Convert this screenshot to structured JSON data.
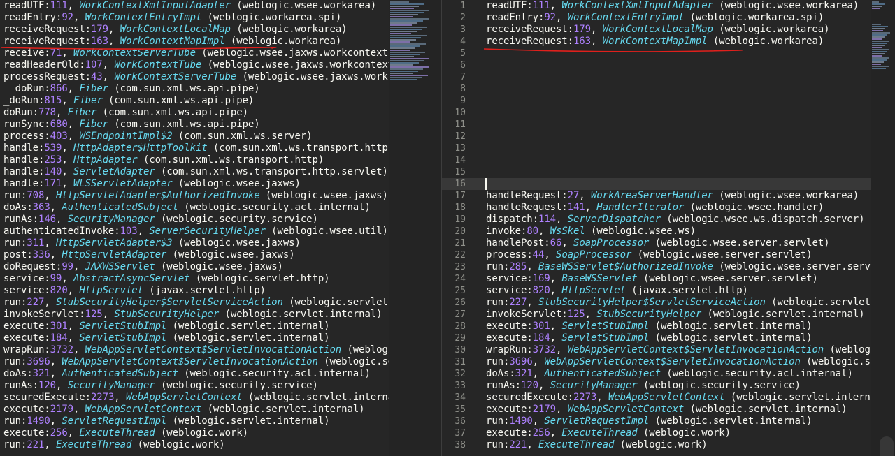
{
  "colors": {
    "background": "#262626",
    "method": "#f8f8f2",
    "line_number": "#ae81ff",
    "class_name": "#66d9ef",
    "annotation_red": "#e0201c",
    "gutter_text": "#8f908a"
  },
  "left_pane": {
    "lines": [
      {
        "m": "readUTF",
        "n": "111",
        "c": "WorkContextXmlInputAdapter",
        "p": "weblogic.wsee.workarea"
      },
      {
        "m": "readEntry",
        "n": "92",
        "c": "WorkContextEntryImpl",
        "p": "weblogic.workarea.spi"
      },
      {
        "m": "receiveRequest",
        "n": "179",
        "c": "WorkContextLocalMap",
        "p": "weblogic.workarea"
      },
      {
        "m": "receiveRequest",
        "n": "163",
        "c": "WorkContextMapImpl",
        "p": "weblogic.workarea"
      },
      {
        "m": "receive",
        "n": "71",
        "c": "WorkContextServerTube",
        "p": "weblogic.wsee.jaxws.workcontext"
      },
      {
        "m": "readHeaderOld",
        "n": "107",
        "c": "WorkContextTube",
        "p": "weblogic.wsee.jaxws.workcontext"
      },
      {
        "m": "processRequest",
        "n": "43",
        "c": "WorkContextServerTube",
        "p": "weblogic.wsee.jaxws.workcon"
      },
      {
        "m": "__doRun",
        "n": "866",
        "c": "Fiber",
        "p": "com.sun.xml.ws.api.pipe"
      },
      {
        "m": "_doRun",
        "n": "815",
        "c": "Fiber",
        "p": "com.sun.xml.ws.api.pipe"
      },
      {
        "m": "doRun",
        "n": "778",
        "c": "Fiber",
        "p": "com.sun.xml.ws.api.pipe"
      },
      {
        "m": "runSync",
        "n": "680",
        "c": "Fiber",
        "p": "com.sun.xml.ws.api.pipe"
      },
      {
        "m": "process",
        "n": "403",
        "c": "WSEndpointImpl$2",
        "p": "com.sun.xml.ws.server"
      },
      {
        "m": "handle",
        "n": "539",
        "c": "HttpAdapter$HttpToolkit",
        "p": "com.sun.xml.ws.transport.http"
      },
      {
        "m": "handle",
        "n": "253",
        "c": "HttpAdapter",
        "p": "com.sun.xml.ws.transport.http"
      },
      {
        "m": "handle",
        "n": "140",
        "c": "ServletAdapter",
        "p": "com.sun.xml.ws.transport.http.servlet"
      },
      {
        "m": "handle",
        "n": "171",
        "c": "WLSServletAdapter",
        "p": "weblogic.wsee.jaxws"
      },
      {
        "m": "run",
        "n": "708",
        "c": "HttpServletAdapter$AuthorizedInvoke",
        "p": "weblogic.wsee.jaxws"
      },
      {
        "m": "doAs",
        "n": "363",
        "c": "AuthenticatedSubject",
        "p": "weblogic.security.acl.internal"
      },
      {
        "m": "runAs",
        "n": "146",
        "c": "SecurityManager",
        "p": "weblogic.security.service"
      },
      {
        "m": "authenticatedInvoke",
        "n": "103",
        "c": "ServerSecurityHelper",
        "p": "weblogic.wsee.util"
      },
      {
        "m": "run",
        "n": "311",
        "c": "HttpServletAdapter$3",
        "p": "weblogic.wsee.jaxws"
      },
      {
        "m": "post",
        "n": "336",
        "c": "HttpServletAdapter",
        "p": "weblogic.wsee.jaxws"
      },
      {
        "m": "doRequest",
        "n": "99",
        "c": "JAXWSServlet",
        "p": "weblogic.wsee.jaxws"
      },
      {
        "m": "service",
        "n": "99",
        "c": "AbstractAsyncServlet",
        "p": "weblogic.servlet.http"
      },
      {
        "m": "service",
        "n": "820",
        "c": "HttpServlet",
        "p": "javax.servlet.http"
      },
      {
        "m": "run",
        "n": "227",
        "c": "StubSecurityHelper$ServletServiceAction",
        "p": "weblogic.servlet.in"
      },
      {
        "m": "invokeServlet",
        "n": "125",
        "c": "StubSecurityHelper",
        "p": "weblogic.servlet.internal"
      },
      {
        "m": "execute",
        "n": "301",
        "c": "ServletStubImpl",
        "p": "weblogic.servlet.internal"
      },
      {
        "m": "execute",
        "n": "184",
        "c": "ServletStubImpl",
        "p": "weblogic.servlet.internal"
      },
      {
        "m": "wrapRun",
        "n": "3732",
        "c": "WebAppServletContext$ServletInvocationAction",
        "p": "weblogic."
      },
      {
        "m": "run",
        "n": "3696",
        "c": "WebAppServletContext$ServletInvocationAction",
        "p": "weblogic.serv"
      },
      {
        "m": "doAs",
        "n": "321",
        "c": "AuthenticatedSubject",
        "p": "weblogic.security.acl.internal"
      },
      {
        "m": "runAs",
        "n": "120",
        "c": "SecurityManager",
        "p": "weblogic.security.service"
      },
      {
        "m": "securedExecute",
        "n": "2273",
        "c": "WebAppServletContext",
        "p": "weblogic.servlet.internal"
      },
      {
        "m": "execute",
        "n": "2179",
        "c": "WebAppServletContext",
        "p": "weblogic.servlet.internal"
      },
      {
        "m": "run",
        "n": "1490",
        "c": "ServletRequestImpl",
        "p": "weblogic.servlet.internal"
      },
      {
        "m": "execute",
        "n": "256",
        "c": "ExecuteThread",
        "p": "weblogic.work"
      },
      {
        "m": "run",
        "n": "221",
        "c": "ExecuteThread",
        "p": "weblogic.work"
      }
    ]
  },
  "right_pane": {
    "line_numbers": [
      "1",
      "2",
      "3",
      "4",
      "5",
      "6",
      "7",
      "8",
      "9",
      "10",
      "11",
      "12",
      "13",
      "14",
      "15",
      "16",
      "17",
      "18",
      "19",
      "20",
      "21",
      "22",
      "23",
      "24",
      "25",
      "26",
      "27",
      "28",
      "29",
      "30",
      "31",
      "32",
      "33",
      "34",
      "35",
      "36",
      "37",
      "38"
    ],
    "current_line": 16,
    "lines": [
      {
        "m": "readUTF",
        "n": "111",
        "c": "WorkContextXmlInputAdapter",
        "p": "weblogic.wsee.workarea"
      },
      {
        "m": "readEntry",
        "n": "92",
        "c": "WorkContextEntryImpl",
        "p": "weblogic.workarea.spi"
      },
      {
        "m": "receiveRequest",
        "n": "179",
        "c": "WorkContextLocalMap",
        "p": "weblogic.workarea"
      },
      {
        "m": "receiveRequest",
        "n": "163",
        "c": "WorkContextMapImpl",
        "p": "weblogic.workarea"
      },
      null,
      null,
      null,
      null,
      null,
      null,
      null,
      null,
      null,
      null,
      null,
      null,
      {
        "m": "handleRequest",
        "n": "27",
        "c": "WorkAreaServerHandler",
        "p": "weblogic.wsee.workarea"
      },
      {
        "m": "handleRequest",
        "n": "141",
        "c": "HandlerIterator",
        "p": "weblogic.wsee.handler"
      },
      {
        "m": "dispatch",
        "n": "114",
        "c": "ServerDispatcher",
        "p": "weblogic.wsee.ws.dispatch.server"
      },
      {
        "m": "invoke",
        "n": "80",
        "c": "WsSkel",
        "p": "weblogic.wsee.ws"
      },
      {
        "m": "handlePost",
        "n": "66",
        "c": "SoapProcessor",
        "p": "weblogic.wsee.server.servlet"
      },
      {
        "m": "process",
        "n": "44",
        "c": "SoapProcessor",
        "p": "weblogic.wsee.server.servlet"
      },
      {
        "m": "run",
        "n": "285",
        "c": "BaseWSServlet$AuthorizedInvoke",
        "p": "weblogic.wsee.server.servlet"
      },
      {
        "m": "service",
        "n": "169",
        "c": "BaseWSServlet",
        "p": "weblogic.wsee.server.servlet"
      },
      {
        "m": "service",
        "n": "820",
        "c": "HttpServlet",
        "p": "javax.servlet.http"
      },
      {
        "m": "run",
        "n": "227",
        "c": "StubSecurityHelper$ServletServiceAction",
        "p": "weblogic.servlet.in"
      },
      {
        "m": "invokeServlet",
        "n": "125",
        "c": "StubSecurityHelper",
        "p": "weblogic.servlet.internal"
      },
      {
        "m": "execute",
        "n": "301",
        "c": "ServletStubImpl",
        "p": "weblogic.servlet.internal"
      },
      {
        "m": "execute",
        "n": "184",
        "c": "ServletStubImpl",
        "p": "weblogic.servlet.internal"
      },
      {
        "m": "wrapRun",
        "n": "3732",
        "c": "WebAppServletContext$ServletInvocationAction",
        "p": "weblogic."
      },
      {
        "m": "run",
        "n": "3696",
        "c": "WebAppServletContext$ServletInvocationAction",
        "p": "weblogic.serv"
      },
      {
        "m": "doAs",
        "n": "321",
        "c": "AuthenticatedSubject",
        "p": "weblogic.security.acl.internal"
      },
      {
        "m": "runAs",
        "n": "120",
        "c": "SecurityManager",
        "p": "weblogic.security.service"
      },
      {
        "m": "securedExecute",
        "n": "2273",
        "c": "WebAppServletContext",
        "p": "weblogic.servlet.internal"
      },
      {
        "m": "execute",
        "n": "2179",
        "c": "WebAppServletContext",
        "p": "weblogic.servlet.internal"
      },
      {
        "m": "run",
        "n": "1490",
        "c": "ServletRequestImpl",
        "p": "weblogic.servlet.internal"
      },
      {
        "m": "execute",
        "n": "256",
        "c": "ExecuteThread",
        "p": "weblogic.work"
      },
      {
        "m": "run",
        "n": "221",
        "c": "ExecuteThread",
        "p": "weblogic.work"
      }
    ]
  }
}
